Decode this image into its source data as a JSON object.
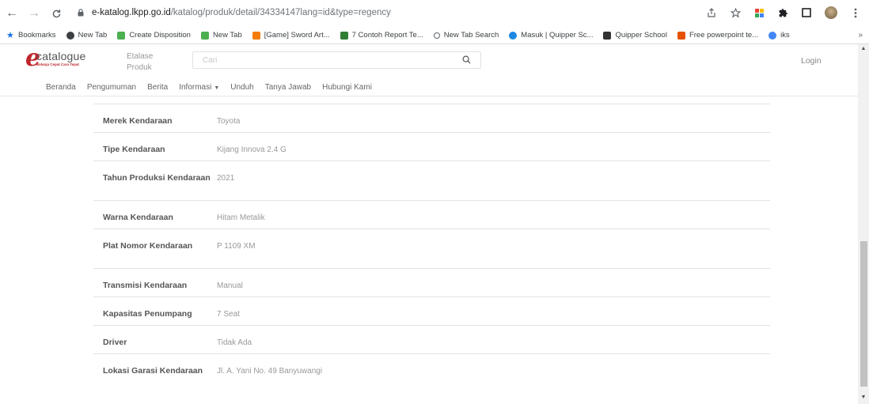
{
  "browser": {
    "url_host": "e-katalog.lkpp.go.id",
    "url_path": "/katalog/produk/detail/34334147lang=id&type=regency",
    "icons": [
      "back-icon",
      "forward-icon",
      "reload-icon",
      "lock-icon",
      "share-icon",
      "star-icon",
      "extension-icon",
      "puzzle-icon",
      "window-icon",
      "avatar"
    ]
  },
  "bookmarks": [
    {
      "label": "Bookmarks",
      "icon": "star-icon",
      "color": "#1a73e8"
    },
    {
      "label": "New Tab",
      "icon": "chrome-icon",
      "color": "#3c4043"
    },
    {
      "label": "Create Disposition",
      "icon": "leaf-icon",
      "color": "#4caf50"
    },
    {
      "label": "New Tab",
      "icon": "leaf-icon",
      "color": "#4caf50"
    },
    {
      "label": "[Game] Sword Art...",
      "icon": "blogger-icon",
      "color": "#f57c00"
    },
    {
      "label": "7 Contoh Report Te...",
      "icon": "bookmark-icon",
      "color": "#2e7d32"
    },
    {
      "label": "New Tab Search",
      "icon": "search-icon",
      "color": "#5f6368"
    },
    {
      "label": "Masuk | Quipper Sc...",
      "icon": "quipper-icon",
      "color": "#1e88e5"
    },
    {
      "label": "Quipper School",
      "icon": "pin-icon",
      "color": "#333333"
    },
    {
      "label": "Free powerpoint te...",
      "icon": "p-icon",
      "color": "#e65100"
    },
    {
      "label": "iks",
      "icon": "google-icon",
      "color": "#4285f4"
    }
  ],
  "site": {
    "logo_word": "catalogue",
    "logo_tag": "Belanja Cepat Cara Tepat",
    "etalase_label": "Etalase Produk",
    "search_placeholder": "Cari",
    "login_label": "Login",
    "nav": [
      {
        "label": "Beranda"
      },
      {
        "label": "Pengumuman"
      },
      {
        "label": "Berita"
      },
      {
        "label": "Informasi",
        "dropdown": true
      },
      {
        "label": "Unduh"
      },
      {
        "label": "Tanya Jawab"
      },
      {
        "label": "Hubungi Kami"
      }
    ]
  },
  "specs": [
    {
      "label": "Merek Kendaraan",
      "value": "Toyota"
    },
    {
      "label": "Tipe Kendaraan",
      "value": "Kijang Innova 2.4 G"
    },
    {
      "label": "Tahun Produksi Kendaraan",
      "value": "2021"
    },
    {
      "label": "Warna Kendaraan",
      "value": "Hitam Metalik"
    },
    {
      "label": "Plat Nomor Kendaraan",
      "value": "P 1109 XM"
    },
    {
      "label": "Transmisi Kendaraan",
      "value": "Manual"
    },
    {
      "label": "Kapasitas Penumpang",
      "value": "7 Seat"
    },
    {
      "label": "Driver",
      "value": "Tidak Ada"
    },
    {
      "label": "Lokasi Garasi Kendaraan",
      "value": "Jl. A. Yani No. 49 Banyuwangi"
    }
  ]
}
